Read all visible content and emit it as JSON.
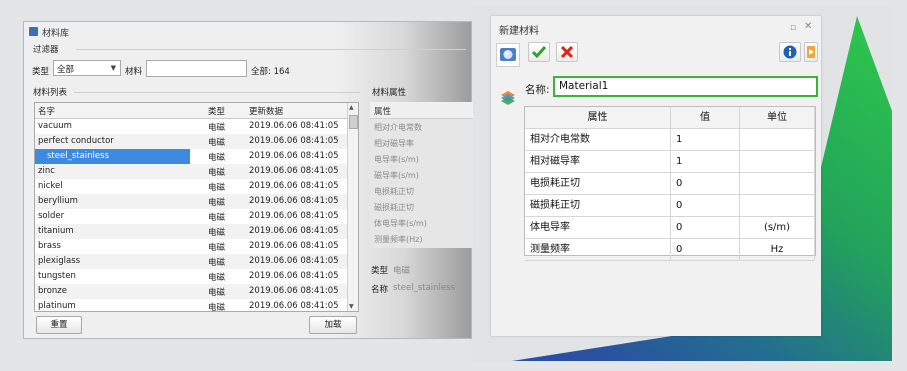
{
  "material_library": {
    "title": "材料库",
    "filter": {
      "group_title": "过滤器",
      "type_label": "类型",
      "type_value": "全部",
      "material_label": "材料",
      "material_value": "",
      "count_text": "全部: 164"
    },
    "list": {
      "group_title": "材料列表",
      "headers": [
        "名字",
        "类型",
        "更新数据"
      ],
      "rows": [
        {
          "name": "vacuum",
          "type": "电磁",
          "date": "2019.06.06 08:41:05"
        },
        {
          "name": "perfect conductor",
          "type": "电磁",
          "date": "2019.06.06 08:41:05"
        },
        {
          "name": "steel_stainless",
          "type": "电磁",
          "date": "2019.06.06 08:41:05"
        },
        {
          "name": "zinc",
          "type": "电磁",
          "date": "2019.06.06 08:41:05"
        },
        {
          "name": "nickel",
          "type": "电磁",
          "date": "2019.06.06 08:41:05"
        },
        {
          "name": "beryllium",
          "type": "电磁",
          "date": "2019.06.06 08:41:05"
        },
        {
          "name": "solder",
          "type": "电磁",
          "date": "2019.06.06 08:41:05"
        },
        {
          "name": "titanium",
          "type": "电磁",
          "date": "2019.06.06 08:41:05"
        },
        {
          "name": "brass",
          "type": "电磁",
          "date": "2019.06.06 08:41:05"
        },
        {
          "name": "plexiglass",
          "type": "电磁",
          "date": "2019.06.06 08:41:05"
        },
        {
          "name": "tungsten",
          "type": "电磁",
          "date": "2019.06.06 08:41:05"
        },
        {
          "name": "bronze",
          "type": "电磁",
          "date": "2019.06.06 08:41:05"
        },
        {
          "name": "platinum",
          "type": "电磁",
          "date": "2019.06.06 08:41:05"
        }
      ],
      "selected_index": 2
    },
    "properties": {
      "group_title": "材料属性",
      "header": "属性",
      "items": [
        "相对介电常数",
        "相对磁导率",
        "电导率(s/m)",
        "磁导率(s/m)",
        "电损耗正切",
        "磁损耗正切",
        "体电导率(s/m)",
        "测量频率(Hz)"
      ],
      "type_label": "类型",
      "type_value": "电磁",
      "name_label": "名称",
      "name_value": "steel_stainless"
    },
    "buttons": {
      "reset": "重置",
      "load": "加载"
    }
  },
  "new_material": {
    "title": "新建材料",
    "name_label": "名称:",
    "name_value": "Material1",
    "grid_headers": [
      "属性",
      "值",
      "单位"
    ],
    "rows": [
      {
        "property": "相对介电常数",
        "value": "1",
        "unit": ""
      },
      {
        "property": "相对磁导率",
        "value": "1",
        "unit": ""
      },
      {
        "property": "电损耗正切",
        "value": "0",
        "unit": ""
      },
      {
        "property": "磁损耗正切",
        "value": "0",
        "unit": ""
      },
      {
        "property": "体电导率",
        "value": "0",
        "unit": "(s/m)"
      },
      {
        "property": "测量频率",
        "value": "0",
        "unit": "Hz"
      }
    ]
  },
  "colors": {
    "accent_green": "#38b33b",
    "selection_blue": "#3d8be0",
    "bg_gradient_green": "#2db84a",
    "bg_gradient_blue": "#2a5aa6"
  }
}
